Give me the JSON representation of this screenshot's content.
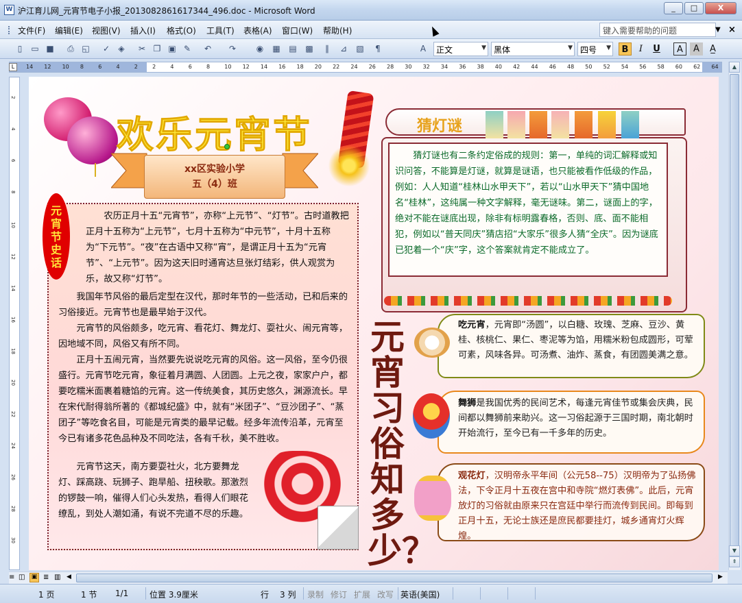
{
  "window": {
    "title": "沪江育儿网_元宵节电子小报_2013082861617344_496.doc - Microsoft Word",
    "min_label": "_",
    "max_label": "□",
    "close_label": "X"
  },
  "menu": {
    "items": [
      "文件(F)",
      "编辑(E)",
      "视图(V)",
      "插入(I)",
      "格式(O)",
      "工具(T)",
      "表格(A)",
      "窗口(W)",
      "帮助(H)"
    ],
    "help_placeholder": "键入需要帮助的问题"
  },
  "format_bar": {
    "style": "正文",
    "font": "黑体",
    "size": "四号",
    "bold": "B",
    "italic": "I",
    "underline": "U"
  },
  "ruler": {
    "h_ticks": [
      "14",
      "12",
      "10",
      "8",
      "6",
      "4",
      "2",
      "2",
      "4",
      "6",
      "8",
      "10",
      "12",
      "14",
      "16",
      "18",
      "20",
      "22",
      "24",
      "26",
      "28",
      "30",
      "32",
      "34",
      "36",
      "38",
      "40",
      "42",
      "44",
      "46",
      "48",
      "50",
      "52",
      "54",
      "56",
      "58",
      "60",
      "62",
      "64"
    ],
    "v_ticks": [
      "2",
      "4",
      "6",
      "8",
      "10",
      "12",
      "14",
      "16",
      "18",
      "20",
      "22",
      "24",
      "26",
      "28",
      "30"
    ]
  },
  "document": {
    "main_title": "欢乐元宵节",
    "school": "xx区实验小学",
    "class": "五（4）班",
    "history_label": "元宵节史话",
    "history_paragraphs": [
      "农历正月十五“元宵节”，亦称“上元节”、“灯节”。古时道教把正月十五称为“上元节”，七月十五称为“中元节”，十月十五称为“下元节”。“夜”在古语中又称“宵”，是谓正月十五为“元宵节”、“上元节”。因为这天旧时通宵达旦张灯结彩，供人观赏为乐，故又称“灯节”。",
      "我国年节风俗的最后定型在汉代，那时年节的一些活动，已和后来的习俗接近。元宵节也是最早始于汉代。",
      "元宵节的风俗颇多，吃元宵、看花灯、舞龙灯、耍社火、闹元宵等，因地域不同，风俗又有所不同。",
      "正月十五闹元宵，当然要先说说吃元宵的风俗。这一风俗，至今仍很盛行。元宵节吃元宵，象征着月满圆、人团圆。上元之夜，家家户户，都要吃糯米面裹着糖馅的元宵。这一传统美食，其历史悠久，渊源流长。早在宋代耐得翁所著的《都城纪盛》中，就有“米团子”、“豆沙团子”、“蒸团子”等吃食名目，可能是元宵类的最早记载。经多年流传沿革，元宵至今已有诸多花色品种及不同吃法，各有千秋，美不胜收。",
      "元宵节这天，南方要耍社火，北方要舞龙灯、踩高跷、玩狮子、跑旱船、扭秧歌。那激烈的锣鼓一响，催得人们心头发热，看得人们眼花缭乱，到处人潮如涌，有说不完道不尽的乐趣。"
    ],
    "riddle_title": "猜灯谜",
    "riddle_text": "猜灯谜也有二条约定俗成的规则：第一，单纯的词汇解释或知识问答，不能算是灯谜，就算是谜语，也只能被看作低级的作品，例如：人人知道“桂林山水甲天下”，若以“山水甲天下”猜中国地名“桂林”，这纯属一种文字解释，毫无谜味。第二，谜面上的字，绝对不能在谜底出现，除非有标明露春格，否则、底、面不能相犯，例如以“普天同庆”猜店招“大家乐”很多人猜“全庆”。因为谜底已犯着一个“庆”字，这个答案就肯定不能成立了。",
    "customs_title": "元宵习俗知多少？",
    "customs": [
      {
        "name": "吃元宵",
        "text": "，元宵即“汤圆”，以白糖、玫瑰、芝麻、豆沙、黄桂、核桃仁、果仁、枣泥等为馅，用糯米粉包成圆形，可荤可素，风味各异。可汤煮、油炸、蒸食，有团圆美满之意。"
      },
      {
        "name": "舞狮",
        "text": "是我国优秀的民间艺术，每逢元宵佳节或集会庆典，民间都以舞狮前来助兴。这一习俗起源于三国时期，南北朝时开始流行，至今已有一千多年的历史。"
      },
      {
        "name": "观花灯",
        "text": "，汉明帝永平年间（公元58--75）汉明帝为了弘扬佛法，下令正月十五夜在宫中和寺院“燃灯表佛”。此后，元宵放灯的习俗就由原来只在宫廷中举行而流传到民间。即每到正月十五，无论士族还是庶民都要挂灯，城乡通宵灯火辉煌。"
      }
    ]
  },
  "status": {
    "page": "1 页",
    "section": "1 节",
    "pages": "1/1",
    "position": "位置 3.9厘米",
    "line": "行",
    "col": "3 列",
    "rec": "录制",
    "trk": "修订",
    "ext": "扩展",
    "ovr": "改写",
    "lang": "英语(美国)"
  },
  "colors": {
    "title_yellow": "#ffe93a",
    "oval_red": "#e00000",
    "riddle_green": "#0b6a2a",
    "scroll_border": "#8a2a34"
  }
}
